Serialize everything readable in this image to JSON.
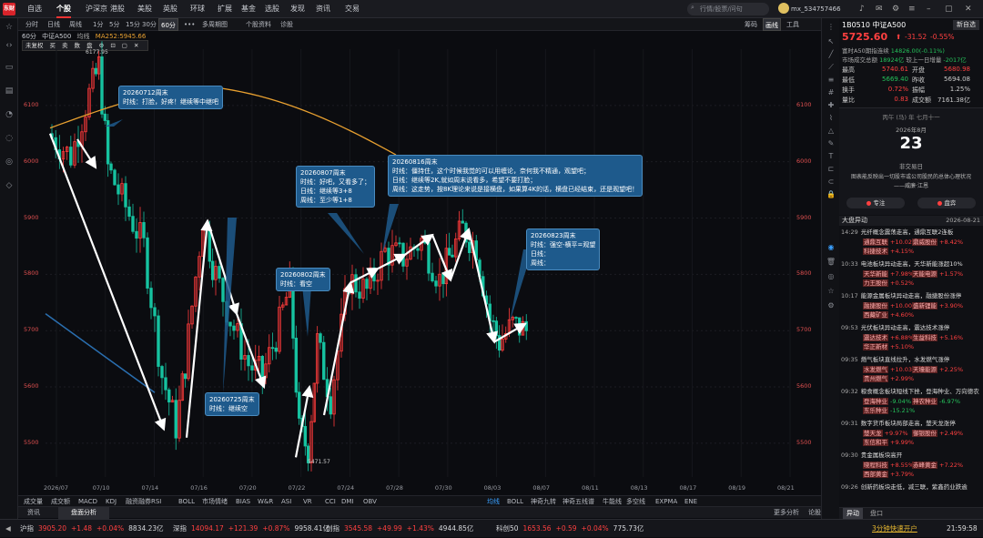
{
  "topbar": {
    "nav": [
      "自选",
      "个股",
      "沪深京",
      "港股",
      "美股",
      "英股",
      "环球",
      "扩展",
      "基金",
      "选股",
      "发现",
      "资讯",
      "交易"
    ],
    "active": 1,
    "search_placeholder": "行情/股票/问句",
    "username": "mx_534757466"
  },
  "subtabs": {
    "items": [
      "分时",
      "日线",
      "周线",
      "1分",
      "5分",
      "15分",
      "30分",
      "60分",
      "•••",
      "多周期图",
      "个股资料",
      "诊股"
    ],
    "selected": "60分",
    "right": [
      "筹码",
      "画线",
      "工具"
    ]
  },
  "chart": {
    "period": "60分",
    "name": "中证A500",
    "style": "均线",
    "ma_label": "MA252:5945.66",
    "toolbar": [
      "未复权",
      "买",
      "卖",
      "数",
      "盘",
      "⚙",
      "⊡",
      "▢",
      "✕"
    ]
  },
  "chart_data": {
    "type": "candlestick",
    "yticks": [
      5500,
      5600,
      5700,
      5800,
      5900,
      6000,
      6100
    ],
    "ylim": [
      5440,
      6200
    ],
    "xticks": [
      "2026/07",
      "07/10",
      "07/14",
      "07/16",
      "07/20",
      "07/22",
      "07/24",
      "07/28",
      "07/30",
      "08/03",
      "08/07",
      "08/11",
      "08/13",
      "08/17",
      "08/19",
      "08/21"
    ],
    "high_label": "6177.95",
    "low_label": "5471.57",
    "ma_color": "#e8a030"
  },
  "annotations": [
    {
      "text": "20260712周末\n时线：打脸，好疼！继续等中继吧"
    },
    {
      "text": "20260725周末\n时线：继续空"
    },
    {
      "text": "20260802周末\n时线：看空"
    },
    {
      "text": "20260807周末\n时线：好吧，又看多了；\n日线：继续等3+8\n周线：至少等1+8"
    },
    {
      "text": "20260816周末\n时线：僵持住，这个时候我觉的可以用缠论，奈何我不精通，观望吧；\n日线：继续等2K,就如周末说看多，希望不要打脸；\n周线：这走势，按8K理论来说是接横盘，如果算4K的话，横盘已经结束，还是观望吧！"
    },
    {
      "text": "20260823周末\n时线：强空-横平=观望\n日线：\n周线："
    }
  ],
  "indicators": [
    "成交量",
    "成交额",
    "MACD",
    "KDJ",
    "融资融券",
    "RSI",
    "BOLL",
    "市场情绪",
    "BIAS",
    "W&R",
    "ASI",
    "VR",
    "CCI",
    "DMI",
    "OBV"
  ],
  "indicators2": [
    "均线",
    "BOLL",
    "神奇九转",
    "神奇五线谱",
    "牛能线",
    "多空线",
    "EXPMA",
    "ENE"
  ],
  "infotabs": [
    "资讯",
    "盘面分析"
  ],
  "infotabs_right": [
    "更多分析",
    "论股堂"
  ],
  "stock": {
    "code": "1B0510",
    "name": "中证A500",
    "price": "5725.60",
    "change": "-31.52",
    "pct": "-0.55%",
    "btn": "新自选",
    "fut": "富时A50期指连续",
    "fut_val": "14826.00(-0.11%)",
    "label1": "市场成交总额",
    "val1": "18924亿",
    "label2": "较上一日增量",
    "val2": "-2017亿",
    "rows": [
      [
        "最高",
        "5740.61",
        "开盘",
        "5680.98"
      ],
      [
        "最低",
        "5669.40",
        "昨收",
        "5694.08"
      ],
      [
        "换手",
        "0.72%",
        "振幅",
        "1.25%"
      ],
      [
        "量比",
        "0.83",
        "成交额",
        "7161.38亿"
      ]
    ]
  },
  "calendar": {
    "header": "丙午 (马) 年 七月十一",
    "month": "2026年8月",
    "day": "23",
    "status": "非交易日",
    "quote": "图表能反映出一切股市或公司股民的总体心理状况",
    "author": "——威廉·江恩",
    "btn1": "专注",
    "btn2": "盘弈"
  },
  "news_header": {
    "title": "大盘异动",
    "date": "2026-08-21"
  },
  "news": [
    {
      "time": "14:29",
      "title": "光纤概念震荡走高，通鼎互联2连板",
      "stocks": [
        [
          "通鼎互联",
          "+10.02%"
        ],
        [
          "鼎威股份",
          "+8.42%"
        ],
        [
          "科捷技术",
          "+4.15%"
        ]
      ]
    },
    {
      "time": "10:33",
      "title": "电池板块异动走高，天华新能涨超10%",
      "stocks": [
        [
          "天华新能",
          "+7.98%"
        ],
        [
          "天能电源",
          "+1.57%"
        ],
        [
          "力王股份",
          "+0.52%"
        ]
      ]
    },
    {
      "time": "10:17",
      "title": "能源金属板块异动走高，融捷股份涨停",
      "stocks": [
        [
          "融捷股份",
          "+10.00%"
        ],
        [
          "盛新锂能",
          "+3.90%"
        ],
        [
          "西藏矿业",
          "+4.60%"
        ]
      ]
    },
    {
      "time": "09:53",
      "title": "光伏板块异动走高，震达技术涨停",
      "stocks": [
        [
          "震达技术",
          "+6.88%"
        ],
        [
          "生益科技",
          "+5.16%"
        ],
        [
          "华正新材",
          "+5.10%"
        ]
      ]
    },
    {
      "time": "09:35",
      "title": "燃气板块直线拉升，水发燃气涨停",
      "stocks": [
        [
          "水发燃气",
          "+10.03%"
        ],
        [
          "天壕能源",
          "+2.25%"
        ],
        [
          "贵州燃气",
          "+2.99%"
        ]
      ]
    },
    {
      "time": "09:32",
      "title": "粮食概念板块短线下挫，登海种业、万向德农",
      "stocks": [
        [
          "登海种业",
          "-9.04%"
        ],
        [
          "神农种业",
          "-6.97%"
        ],
        [
          "东乐种业",
          "-15.21%"
        ]
      ]
    },
    {
      "time": "09:31",
      "title": "数字货币板块局部走高，楚天龙涨停",
      "stocks": [
        [
          "楚天龙",
          "+9.97%"
        ],
        [
          "御银股份",
          "+2.49%"
        ],
        [
          "东信和平",
          "+9.99%"
        ]
      ]
    },
    {
      "time": "09:30",
      "title": "贵金属板块高开",
      "stocks": [
        [
          "晓程科技",
          "+8.55%"
        ],
        [
          "赤峰黄金",
          "+7.22%"
        ],
        [
          "西部黄金",
          "+3.79%"
        ]
      ]
    },
    {
      "time": "09:26",
      "title": "创新药板块走低，减三联，紫鑫药业跌逾",
      "stocks": []
    }
  ],
  "rpanel_tabs": [
    "异动",
    "盘口"
  ],
  "ticker": [
    {
      "name": "沪指",
      "price": "3905.20",
      "chg": "+1.48",
      "pct": "+0.04%",
      "amt": "8834.23亿"
    },
    {
      "name": "深指",
      "price": "14094.17",
      "chg": "+121.39",
      "pct": "+0.87%",
      "amt": "9958.41亿"
    },
    {
      "name": "创指",
      "price": "3545.58",
      "chg": "+49.99",
      "pct": "+1.43%",
      "amt": "4944.85亿"
    },
    {
      "name": "科创50",
      "price": "1653.56",
      "chg": "+0.59",
      "pct": "+0.04%",
      "amt": "775.73亿"
    }
  ],
  "ticker_right": "3分钟快速开户",
  "time": "21:59:58"
}
